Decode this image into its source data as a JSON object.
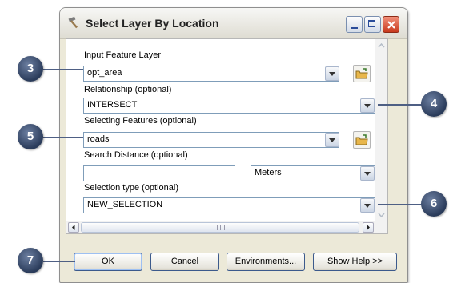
{
  "dialog": {
    "title": "Select Layer By Location"
  },
  "form": {
    "input_feature_layer": {
      "label": "Input Feature Layer",
      "value": "opt_area"
    },
    "relationship": {
      "label": "Relationship (optional)",
      "value": "INTERSECT"
    },
    "selecting_features": {
      "label": "Selecting Features (optional)",
      "value": "roads"
    },
    "search_distance": {
      "label": "Search Distance (optional)",
      "value": "",
      "unit": "Meters"
    },
    "selection_type": {
      "label": "Selection type (optional)",
      "value": "NEW_SELECTION"
    }
  },
  "scrollbar": {
    "grip_text": "III"
  },
  "buttons": {
    "ok": "OK",
    "cancel": "Cancel",
    "environments": "Environments...",
    "show_help": "Show Help >>"
  },
  "callouts": [
    "3",
    "4",
    "5",
    "6",
    "7"
  ],
  "colors": {
    "callout": "#2f4266",
    "accent": "#7f9db9",
    "close_button": "#c83a1d"
  }
}
